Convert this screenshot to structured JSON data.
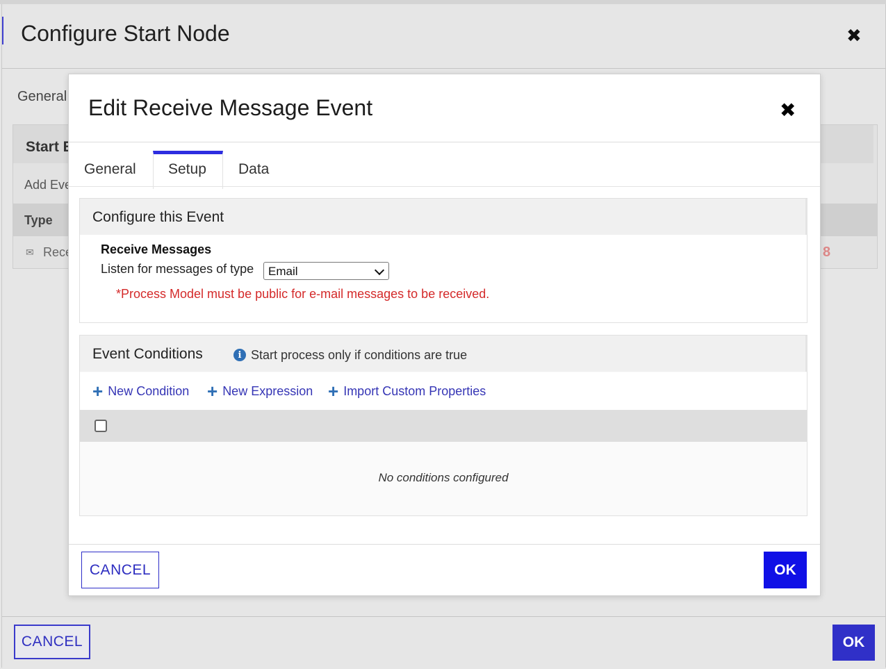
{
  "outer": {
    "title": "Configure Start Node",
    "tab_general": "General",
    "panel_title": "Start E",
    "add_event": "Add Eve",
    "column_type": "Type",
    "row_text": "Rece",
    "row_marker": "8",
    "cancel_label": "CANCEL",
    "ok_label": "OK"
  },
  "modal": {
    "title": "Edit Receive Message Event",
    "close_glyph": "✖",
    "tabs": [
      {
        "label": "General",
        "active": false
      },
      {
        "label": "Setup",
        "active": true
      },
      {
        "label": "Data",
        "active": false
      }
    ],
    "configure": {
      "title": "Configure this Event",
      "receive_label": "Receive Messages",
      "listen_label": "Listen for messages of type",
      "message_type": "Email",
      "warning": "*Process Model must be public for e-mail messages to be received."
    },
    "conditions": {
      "title": "Event Conditions",
      "info_text": "Start process only if conditions are true",
      "actions": [
        "New Condition",
        "New Expression",
        "Import Custom Properties"
      ],
      "empty_text": "No conditions configured"
    },
    "cancel_label": "CANCEL",
    "ok_label": "OK"
  },
  "colors": {
    "accent": "#2d2de0",
    "primary_button": "#1010e6",
    "link": "#3535b5",
    "warning": "#d42a2a",
    "info_icon": "#2f6fb5"
  },
  "icons": {
    "close": "close-icon",
    "info": "info-icon",
    "plus": "plus-icon",
    "mail": "mail-icon",
    "dropdown": "chevron-down-icon"
  }
}
